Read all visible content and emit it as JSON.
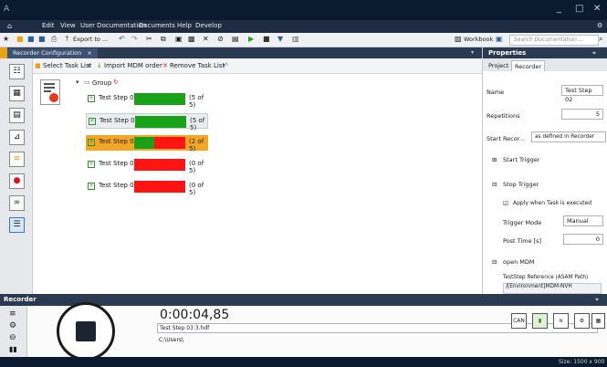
{
  "titlebar": {
    "logo": "A",
    "minimize": "_",
    "maximize": "□",
    "close": "✕"
  },
  "menu": {
    "home_icon": "home-icon",
    "items": [
      "Edit",
      "View",
      "User Documentation",
      "Documents",
      "Help",
      "Develop"
    ],
    "settings_icon": "gear-icon"
  },
  "toolbar": {
    "export_label": "Export to ...",
    "workbook_label": "Workbook",
    "search_placeholder": "Search Documentation ..."
  },
  "doc_tab": {
    "label": "Recorder Configuration",
    "close": "×"
  },
  "subtoolbar": {
    "select_task_list": "Select Task List",
    "import_mdm": "Import MDM order",
    "remove_task_list": "Remove Task List"
  },
  "tree": {
    "group_label": "Group",
    "steps": [
      {
        "label": "Test Step 01",
        "completed": 5,
        "total": 5,
        "count": "(5 of 5)",
        "selected": false,
        "hover": false
      },
      {
        "label": "Test Step 02",
        "completed": 5,
        "total": 5,
        "count": "(5 of 5)",
        "selected": false,
        "hover": true
      },
      {
        "label": "Test Step 03",
        "completed": 2,
        "total": 5,
        "count": "(2 of 5)",
        "selected": true,
        "hover": false
      },
      {
        "label": "Test Step 04",
        "completed": 0,
        "total": 5,
        "count": "(0 of 5)",
        "selected": false,
        "hover": false
      },
      {
        "label": "Test Step 05",
        "completed": 0,
        "total": 5,
        "count": "(0 of 5)",
        "selected": false,
        "hover": false
      }
    ]
  },
  "colors": {
    "done": "#1aa11a",
    "todo": "#ff1414",
    "selected_row": "#f5a623",
    "titlebar": "#0b1a2e",
    "panel_header": "#2a3a50"
  },
  "properties": {
    "title": "Properties",
    "tabs": [
      "Project",
      "Recorder"
    ],
    "name_label": "Name",
    "name_value": "Test Step 02",
    "repetitions_label": "Repetitions",
    "repetitions_value": "5",
    "start_recorder_label": "Start Recor...",
    "start_recorder_value": "as defined in Recorder",
    "start_trigger_label": "Start Trigger",
    "stop_trigger_label": "Stop Trigger",
    "apply_label": "Apply when Task is executed",
    "trigger_mode_label": "Trigger Mode",
    "trigger_mode_value": "Manual",
    "post_time_label": "Post Time [s]",
    "post_time_value": "0",
    "open_mdm_label": "open MDM",
    "teststep_ref_label": "TestStep Reference (ASAM Path)",
    "ref_line1": "/[Environment]MDM-NVH",
    "ref_line2": "/[Project]Z_NVHMDM"
  },
  "recorder": {
    "title": "Recorder",
    "time": "0:00:04,85",
    "filename": "Test Step 03 3.hdf",
    "path": "C:\\Users\\",
    "can_label": "CAN"
  },
  "status": {
    "size": "Size: 1500 x 900"
  }
}
